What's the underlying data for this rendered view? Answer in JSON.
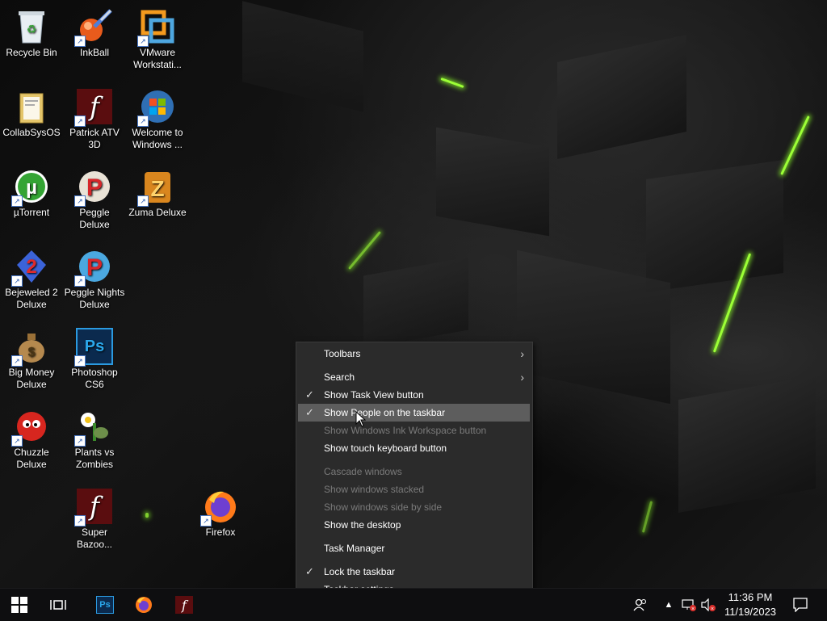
{
  "desktop": {
    "icons": [
      {
        "label": "Recycle Bin",
        "icon": "recycle-bin-icon"
      },
      {
        "label": "InkBall",
        "icon": "inkball-icon"
      },
      {
        "label": "VMware Workstati...",
        "icon": "vmware-icon"
      },
      {
        "label": "CollabSysOS",
        "icon": "folder-icon"
      },
      {
        "label": "Patrick ATV 3D",
        "icon": "flash-icon"
      },
      {
        "label": "Welcome to Windows ...",
        "icon": "windows-logo-icon"
      },
      {
        "label": "µTorrent",
        "icon": "utorrent-icon"
      },
      {
        "label": "Peggle Deluxe",
        "icon": "peggle-icon"
      },
      {
        "label": "Zuma Deluxe",
        "icon": "zuma-icon"
      },
      {
        "label": "Bejeweled 2 Deluxe",
        "icon": "bejeweled-icon"
      },
      {
        "label": "Peggle Nights Deluxe",
        "icon": "peggle-nights-icon"
      },
      {
        "label": "Big Money Deluxe",
        "icon": "money-bag-icon"
      },
      {
        "label": "Photoshop CS6",
        "icon": "photoshop-icon"
      },
      {
        "label": "Chuzzle Deluxe",
        "icon": "chuzzle-icon"
      },
      {
        "label": "Plants vs Zombies",
        "icon": "plants-vs-zombies-icon"
      },
      {
        "label": "Super Bazoo...",
        "icon": "flash-icon"
      },
      {
        "label": "Firefox",
        "icon": "firefox-icon"
      }
    ]
  },
  "context_menu": {
    "items": [
      {
        "label": "Toolbars",
        "submenu": true
      },
      {
        "label": "Search",
        "submenu": true
      },
      {
        "label": "Show Task View button",
        "checked": true
      },
      {
        "label": "Show People on the taskbar",
        "checked": true,
        "highlighted": true
      },
      {
        "label": "Show Windows Ink Workspace button",
        "disabled": true
      },
      {
        "label": "Show touch keyboard button"
      },
      {
        "label": "Cascade windows",
        "disabled": true
      },
      {
        "label": "Show windows stacked",
        "disabled": true
      },
      {
        "label": "Show windows side by side",
        "disabled": true
      },
      {
        "label": "Show the desktop"
      },
      {
        "label": "Task Manager"
      },
      {
        "label": "Lock the taskbar",
        "checked": true
      },
      {
        "label": "Taskbar settings"
      }
    ]
  },
  "taskbar": {
    "start_icon": "windows-start-icon",
    "task_view_icon": "task-view-icon",
    "pinned": [
      {
        "name": "Photoshop",
        "icon": "photoshop-icon",
        "glyph": "Ps"
      },
      {
        "name": "Firefox",
        "icon": "firefox-icon"
      },
      {
        "name": "Flash",
        "icon": "flash-icon",
        "glyph": "f"
      }
    ],
    "tray": {
      "people_icon": "people-icon",
      "overflow_icon": "chevron-up-icon",
      "network_icon": "network-error-icon",
      "volume_icon": "volume-muted-icon",
      "time": "11:36 PM",
      "date": "11/19/2023",
      "notification_icon": "action-center-icon"
    }
  },
  "colors": {
    "menu_bg": "#2b2b2b",
    "menu_highlight": "#5d5d5d",
    "menu_disabled_text": "#7a7a7a",
    "taskbar_bg": "#0e0e10",
    "wallpaper_glow": "#9cff36"
  }
}
